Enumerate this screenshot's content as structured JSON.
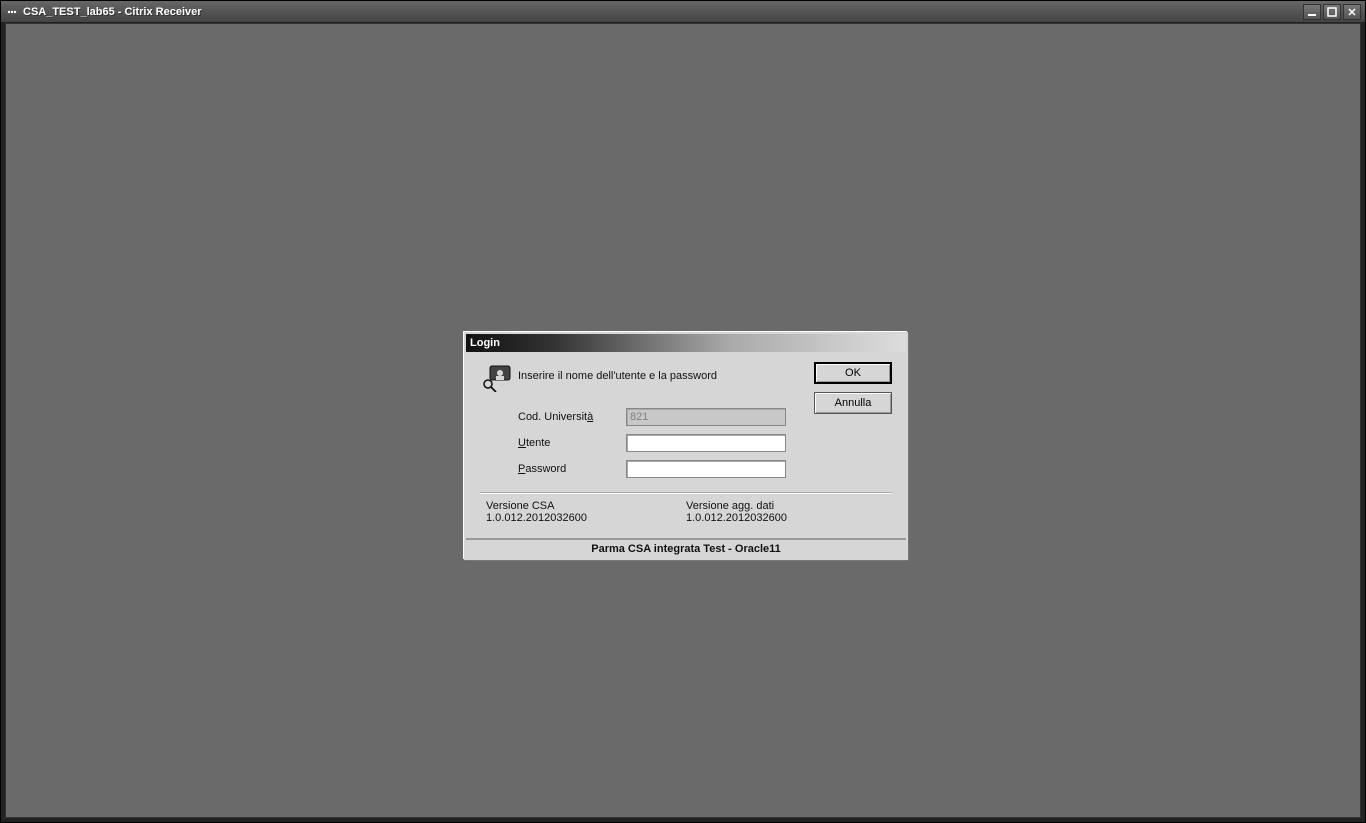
{
  "window": {
    "title": "CSA_TEST_lab65 - Citrix Receiver"
  },
  "dialog": {
    "title": "Login",
    "instruction": "Inserire il nome dell'utente e la password",
    "buttons": {
      "ok": "OK",
      "cancel": "Annulla"
    },
    "fields": {
      "cod_label_pre": "Cod. Universit",
      "cod_label_accel": "à",
      "cod_value": "821",
      "user_label_accel": "U",
      "user_label_rest": "tente",
      "user_value": "",
      "pass_label_accel": "P",
      "pass_label_rest": "assword",
      "pass_value": ""
    },
    "versions": {
      "csa_label": "Versione CSA",
      "csa_value": "1.0.012.2012032600",
      "agg_label": "Versione agg. dati",
      "agg_value": "1.0.012.2012032600"
    },
    "footer": "Parma CSA integrata Test - Oracle11"
  }
}
